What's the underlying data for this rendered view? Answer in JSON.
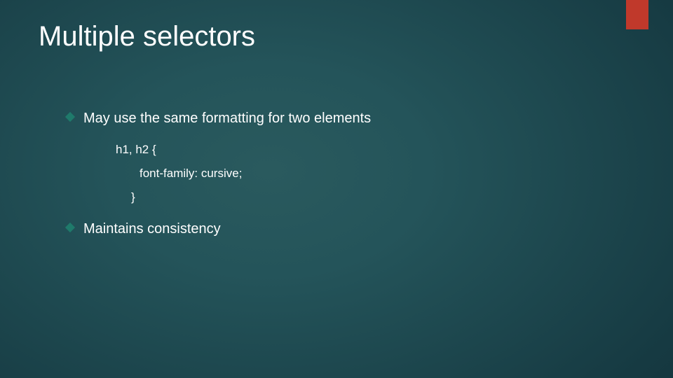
{
  "title": "Multiple selectors",
  "bullets": {
    "item1": "May use the same formatting for two elements",
    "item2": "Maintains consistency"
  },
  "code": {
    "line1": "h1, h2 {",
    "line2": "font-family: cursive;",
    "line3": "}"
  },
  "colors": {
    "accent": "#c0392b",
    "bullet_diamond": "#1f7a6b",
    "background_center": "#2a5a5e",
    "background_edge": "#112f37",
    "text": "#ffffff"
  }
}
